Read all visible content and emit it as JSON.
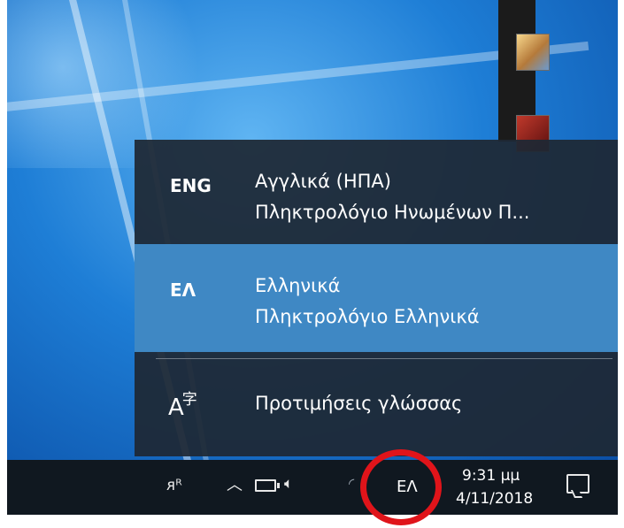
{
  "flyout": {
    "languages": [
      {
        "code": "ENG",
        "name": "Αγγλικά (ΗΠΑ)",
        "layout": "Πληκτρολόγιο Ηνωμένων Π..."
      },
      {
        "code": "ΕΛ",
        "name": "Ελληνικά",
        "layout": "Πληκτρολόγιο Ελληνικά"
      }
    ],
    "selected_index": 1,
    "preferences_label": "Προτιμήσεις γλώσσας",
    "preferences_icon": {
      "a": "A",
      "ji": "字"
    }
  },
  "taskbar": {
    "language_indicator": "ΕΛ",
    "time": "9:31 μμ",
    "date": "4/11/2018"
  },
  "icons": {
    "people": "people-icon",
    "chevron": "chevron-up-icon",
    "battery": "battery-icon",
    "speaker": "speaker-icon",
    "wifi": "wifi-icon",
    "notifications": "action-center-icon",
    "language_prefs": "language-prefs-icon"
  },
  "colors": {
    "selected": "#3f88c4",
    "flyout_bg": "#1e2834",
    "taskbar_bg": "#101820",
    "annotation": "#e0141a"
  }
}
